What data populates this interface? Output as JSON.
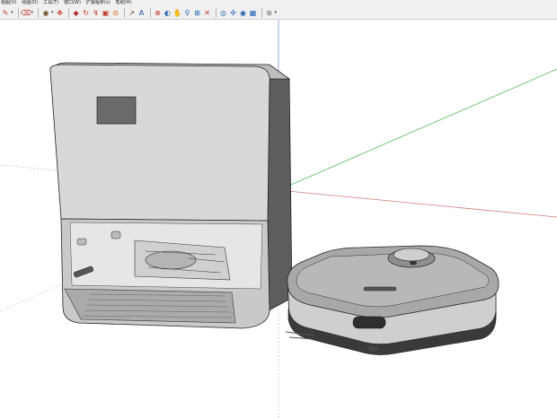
{
  "menubar": {
    "items": [
      "视图(V)",
      "绘图(D)",
      "工具(T)",
      "窗口(W)",
      "扩展程序(x)",
      "帮助(H)"
    ]
  },
  "toolbar": {
    "icons": [
      {
        "name": "pencil-icon",
        "glyph": "✎",
        "color": "#c0392b"
      },
      {
        "name": "eraser-icon",
        "glyph": "⌫",
        "color": "#c0392b"
      },
      {
        "name": "paint-bucket-icon",
        "glyph": "◉",
        "color": "#6d4c1f"
      },
      {
        "name": "move-icon",
        "glyph": "✥",
        "color": "#c0392b"
      },
      {
        "name": "push-pull-icon",
        "glyph": "◆",
        "color": "#b03030"
      },
      {
        "name": "rotate-icon",
        "glyph": "↻",
        "color": "#c0392b"
      },
      {
        "name": "follow-me-icon",
        "glyph": "↯",
        "color": "#c0392b"
      },
      {
        "name": "scale-icon",
        "glyph": "▣",
        "color": "#c0392b"
      },
      {
        "name": "offset-icon",
        "glyph": "⊙",
        "color": "#d35400"
      },
      {
        "name": "tape-measure-icon",
        "glyph": "↗",
        "color": "#6d4c1f"
      },
      {
        "name": "text-icon",
        "glyph": "A",
        "color": "#1f4fa0"
      },
      {
        "name": "axes-icon",
        "glyph": "⊕",
        "color": "#c0392b"
      },
      {
        "name": "orbit-icon",
        "glyph": "◐",
        "color": "#1f5fb0"
      },
      {
        "name": "pan-icon",
        "glyph": "✋",
        "color": "#1f5fb0"
      },
      {
        "name": "zoom-icon",
        "glyph": "⚲",
        "color": "#1f5fb0"
      },
      {
        "name": "zoom-window-icon",
        "glyph": "⊞",
        "color": "#1f5fb0"
      },
      {
        "name": "zoom-extents-icon",
        "glyph": "✕",
        "color": "#c0392b"
      },
      {
        "name": "position-camera-icon",
        "glyph": "◎",
        "color": "#1f5fb0"
      },
      {
        "name": "walk-icon",
        "glyph": "✣",
        "color": "#1f5fb0"
      },
      {
        "name": "look-around-icon",
        "glyph": "◉",
        "color": "#1f5fb0"
      },
      {
        "name": "section-plane-icon",
        "glyph": "▦",
        "color": "#1f5fb0"
      },
      {
        "name": "styles-icon",
        "glyph": "⊛",
        "color": "#666666"
      }
    ],
    "dropdown_glyph": "▾"
  },
  "viewport": {
    "background": "#ffffff",
    "axis_colors": {
      "red": "#d07a7a",
      "green": "#56b856",
      "blue": "#7b8fcc"
    },
    "model_fill": "#d6d6d6",
    "model_dark": "#4a4a4a",
    "model_edge": "#222222"
  }
}
